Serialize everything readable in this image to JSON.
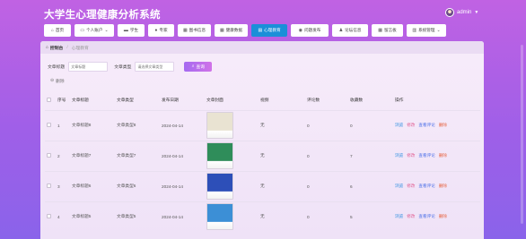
{
  "header": {
    "title": "大学生心理健康分析系统",
    "user": "admin"
  },
  "nav": [
    {
      "label": "首页",
      "icon": "home-icon"
    },
    {
      "label": "个人账户",
      "icon": "account-icon"
    },
    {
      "label": "学生",
      "icon": "monitor-icon"
    },
    {
      "label": "专家",
      "icon": "person-icon"
    },
    {
      "label": "图书信息",
      "icon": "grid-icon"
    },
    {
      "label": "健康数据",
      "icon": "grid-icon"
    },
    {
      "label": "心理教育",
      "icon": "book-icon",
      "active": true
    },
    {
      "label": "问题发布",
      "icon": "chat-icon"
    },
    {
      "label": "论坛信息",
      "icon": "user-icon"
    },
    {
      "label": "留言板",
      "icon": "grid-icon"
    },
    {
      "label": "系统管理",
      "icon": "chart-icon"
    }
  ],
  "breadcrumb": {
    "home": "控制台",
    "sep": "/",
    "current": "心理教育"
  },
  "search": {
    "title_label": "文章标题",
    "title_placeholder": "文章标题",
    "type_label": "文章类型",
    "type_placeholder": "请选择文章类型",
    "search_button": "查询"
  },
  "delete_button": "删除",
  "table": {
    "headers": [
      "序号",
      "文章标题",
      "文章类型",
      "发布日期",
      "文章封面",
      "视频",
      "评论数",
      "收藏数",
      "操作"
    ],
    "rows": [
      {
        "index": "1",
        "title": "文章标题8",
        "type": "文章类型8",
        "date": "2024-04-14",
        "video": "无",
        "comments": "0",
        "favorites": "0",
        "cover_color": "#e9e3d2"
      },
      {
        "index": "2",
        "title": "文章标题7",
        "type": "文章类型7",
        "date": "2024-04-14",
        "video": "无",
        "comments": "0",
        "favorites": "7",
        "cover_color": "#2f8d5a"
      },
      {
        "index": "3",
        "title": "文章标题6",
        "type": "文章类型6",
        "date": "2024-04-14",
        "video": "无",
        "comments": "0",
        "favorites": "6",
        "cover_color": "#2d4fb8"
      },
      {
        "index": "4",
        "title": "文章标题5",
        "type": "文章类型5",
        "date": "2024-04-14",
        "video": "无",
        "comments": "0",
        "favorites": "5",
        "cover_color": "#3c8fd6"
      }
    ],
    "ops": {
      "view": "浏览",
      "edit": "修改",
      "comments": "查看评论",
      "delete": "删除"
    }
  }
}
